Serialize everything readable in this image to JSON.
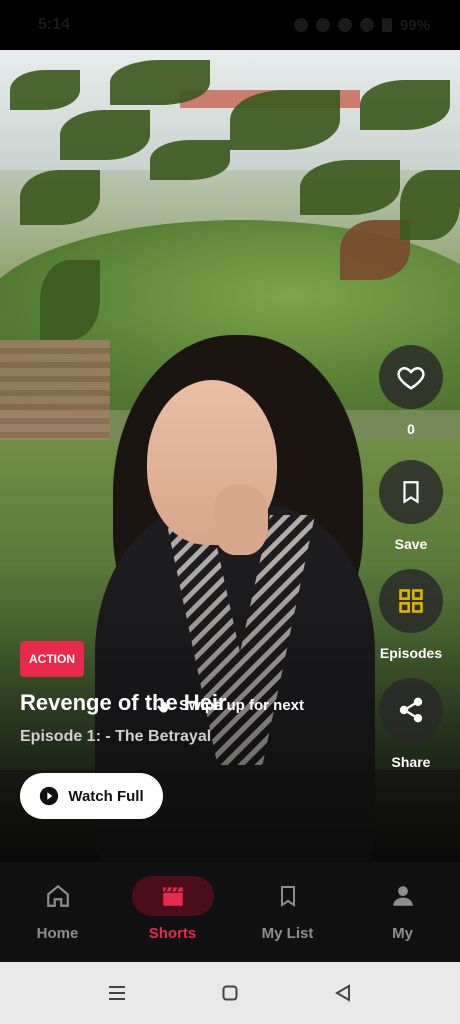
{
  "status_bar": {
    "time": "5:14",
    "battery": "99%"
  },
  "video": {
    "genre_tag": "ACTION",
    "show_title": "Revenge of the Heir",
    "episode_title": "Episode 1: - The Betrayal",
    "swipe_hint": "Swipe up for next",
    "watch_button_label": "Watch Full"
  },
  "actions": {
    "like_count": "0",
    "save_label": "Save",
    "episodes_label": "Episodes",
    "share_label": "Share"
  },
  "bottom_nav": {
    "items": [
      {
        "label": "Home",
        "icon": "home-icon",
        "active": false
      },
      {
        "label": "Shorts",
        "icon": "clapperboard-icon",
        "active": true
      },
      {
        "label": "My List",
        "icon": "bookmark-icon",
        "active": false
      },
      {
        "label": "My",
        "icon": "profile-icon",
        "active": false
      }
    ]
  },
  "colors": {
    "accent": "#e8294c",
    "episodes_icon": "#e2b500",
    "nav_background": "#111111"
  }
}
